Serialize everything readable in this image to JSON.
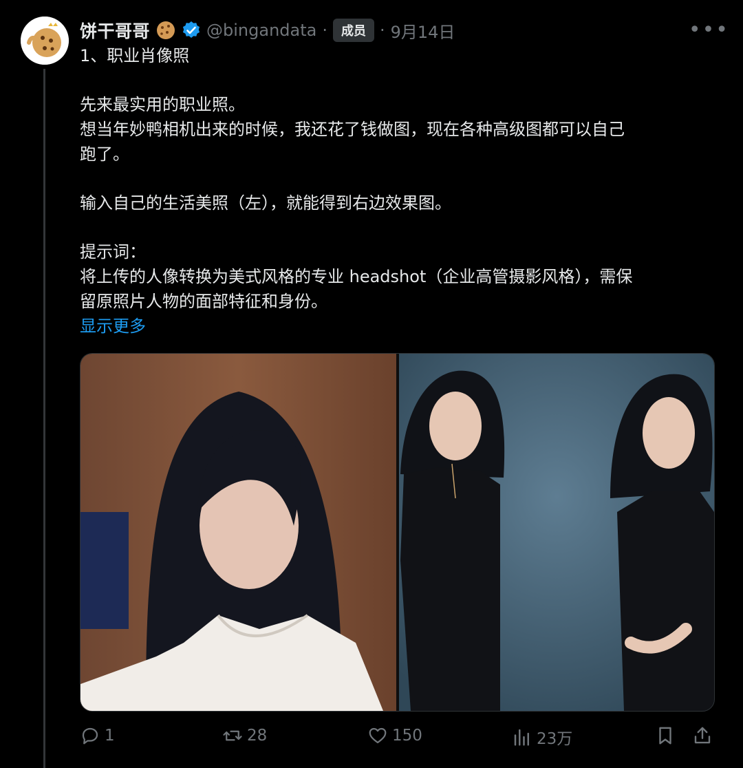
{
  "author": {
    "display_name": "饼干哥哥",
    "handle": "@bingandata",
    "badge": "成员",
    "date": "9月14日",
    "verified": true
  },
  "post": {
    "line1": "1、职业肖像照",
    "line2": "先来最实用的职业照。",
    "line3": "想当年妙鸭相机出来的时候，我还花了钱做图，现在各种高级图都可以自己",
    "line4": "跑了。",
    "line5": "输入自己的生活美照（左），就能得到右边效果图。",
    "line6": "提示词：",
    "line7": "将上传的人像转换为美式风格的专业 headshot（企业高管摄影风格），需保",
    "line8": "留原照片人物的面部特征和身份。",
    "show_more": "显示更多"
  },
  "actions": {
    "replies": "1",
    "reposts": "28",
    "likes": "150",
    "views": "23万"
  },
  "icons": {
    "more": "more-horizontal-icon",
    "reply": "reply-icon",
    "repost": "repost-icon",
    "like": "heart-icon",
    "views": "bar-chart-icon",
    "bookmark": "bookmark-icon",
    "share": "share-icon",
    "verified": "verified-badge-icon",
    "cookie": "cookie-emoji-icon"
  },
  "colors": {
    "background": "#000000",
    "text": "#e7e9ea",
    "muted": "#71767b",
    "link": "#1d9bf0",
    "verified": "#1d9bf0"
  }
}
